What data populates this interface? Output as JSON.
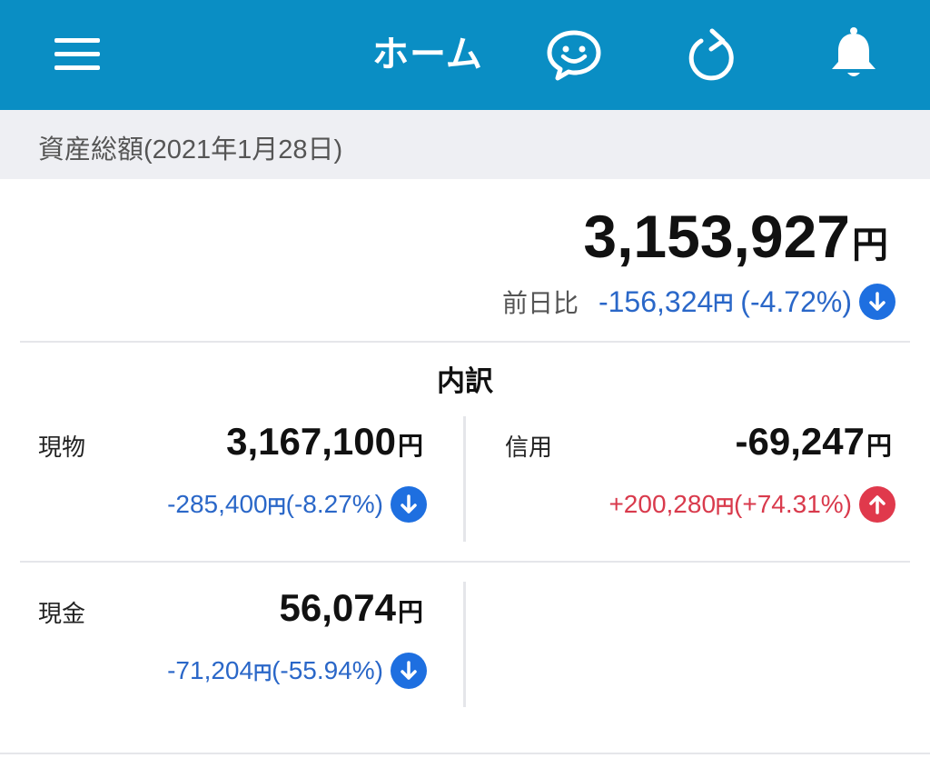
{
  "header": {
    "title": "ホーム",
    "bg_color": "#0a8ec4",
    "icons": [
      "menu-icon",
      "chat-smile-icon",
      "refresh-icon",
      "bell-icon"
    ]
  },
  "summary": {
    "section_label": "資産総額(2021年1月28日)",
    "total_amount": "3,153,927",
    "yen": "円",
    "diff_label": "前日比",
    "diff_amount": "-156,324",
    "diff_yen": "円",
    "diff_pct": "(-4.72%)",
    "diff_direction": "down"
  },
  "breakdown": {
    "title": "内訳",
    "items": [
      {
        "label": "現物",
        "amount": "3,167,100",
        "yen": "円",
        "change": "-285,400",
        "change_yen": "円",
        "change_pct": "(-8.27%)",
        "direction": "down"
      },
      {
        "label": "信用",
        "amount": "-69,247",
        "yen": "円",
        "change": "+200,280",
        "change_yen": "円",
        "change_pct": "(+74.31%)",
        "direction": "up"
      },
      {
        "label": "現金",
        "amount": "56,074",
        "yen": "円",
        "change": "-71,204",
        "change_yen": "円",
        "change_pct": "(-55.94%)",
        "direction": "down"
      }
    ]
  },
  "colors": {
    "up": "#d93a4c",
    "down": "#2a67c8",
    "divider": "#e5e6ea"
  }
}
